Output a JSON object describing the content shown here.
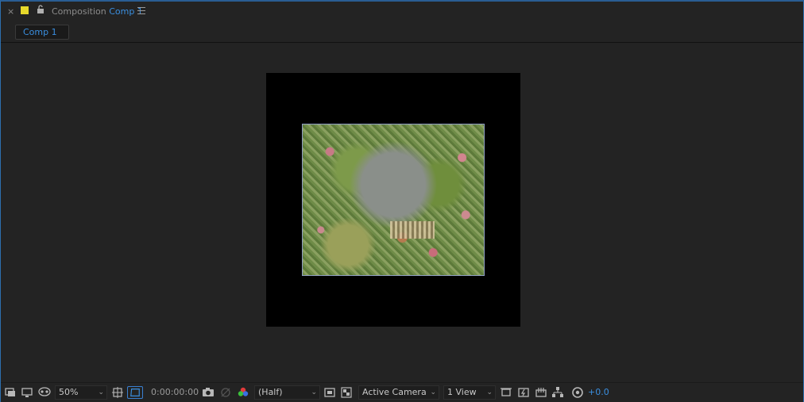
{
  "header": {
    "close_glyph": "×",
    "label_color": "#e6d82b",
    "title_prefix": "Composition",
    "comp_name": "Comp 1",
    "menu_icon": "hamburger-menu-icon"
  },
  "tabs": [
    {
      "label": "Comp 1"
    }
  ],
  "viewer": {
    "frame_color": "#000000",
    "layer_border_color": "#8f9ec3"
  },
  "toolbar": {
    "zoom": "50%",
    "timecode": "0:00:00:00",
    "resolution": "(Half)",
    "camera": "Active Camera",
    "view_layout": "1 View",
    "exposure": "+0.0",
    "accent_color": "#3a8fe0"
  }
}
